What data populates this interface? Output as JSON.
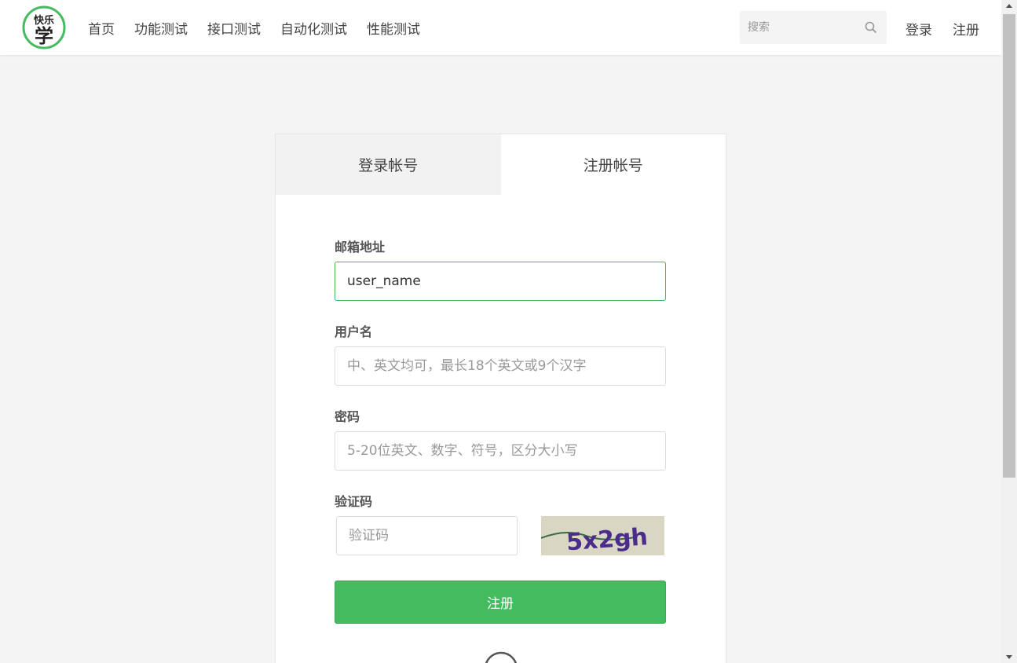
{
  "logo": {
    "text_top": "快乐",
    "text_main": "学"
  },
  "nav": {
    "items": [
      "首页",
      "功能测试",
      "接口测试",
      "自动化测试",
      "性能测试"
    ]
  },
  "search": {
    "placeholder": "搜索"
  },
  "header_links": {
    "login": "登录",
    "register": "注册"
  },
  "tabs": {
    "login": "登录帐号",
    "register": "注册帐号"
  },
  "form": {
    "email": {
      "label": "邮箱地址",
      "value": "user_name"
    },
    "username": {
      "label": "用户名",
      "placeholder": "中、英文均可，最长18个英文或9个汉字"
    },
    "password": {
      "label": "密码",
      "placeholder": "5-20位英文、数字、符号，区分大小写"
    },
    "captcha": {
      "label": "验证码",
      "placeholder": "验证码",
      "image_text": "5x2gh"
    },
    "submit": "注册"
  },
  "colors": {
    "accent": "#43bc60",
    "background": "#f4f4f4"
  }
}
